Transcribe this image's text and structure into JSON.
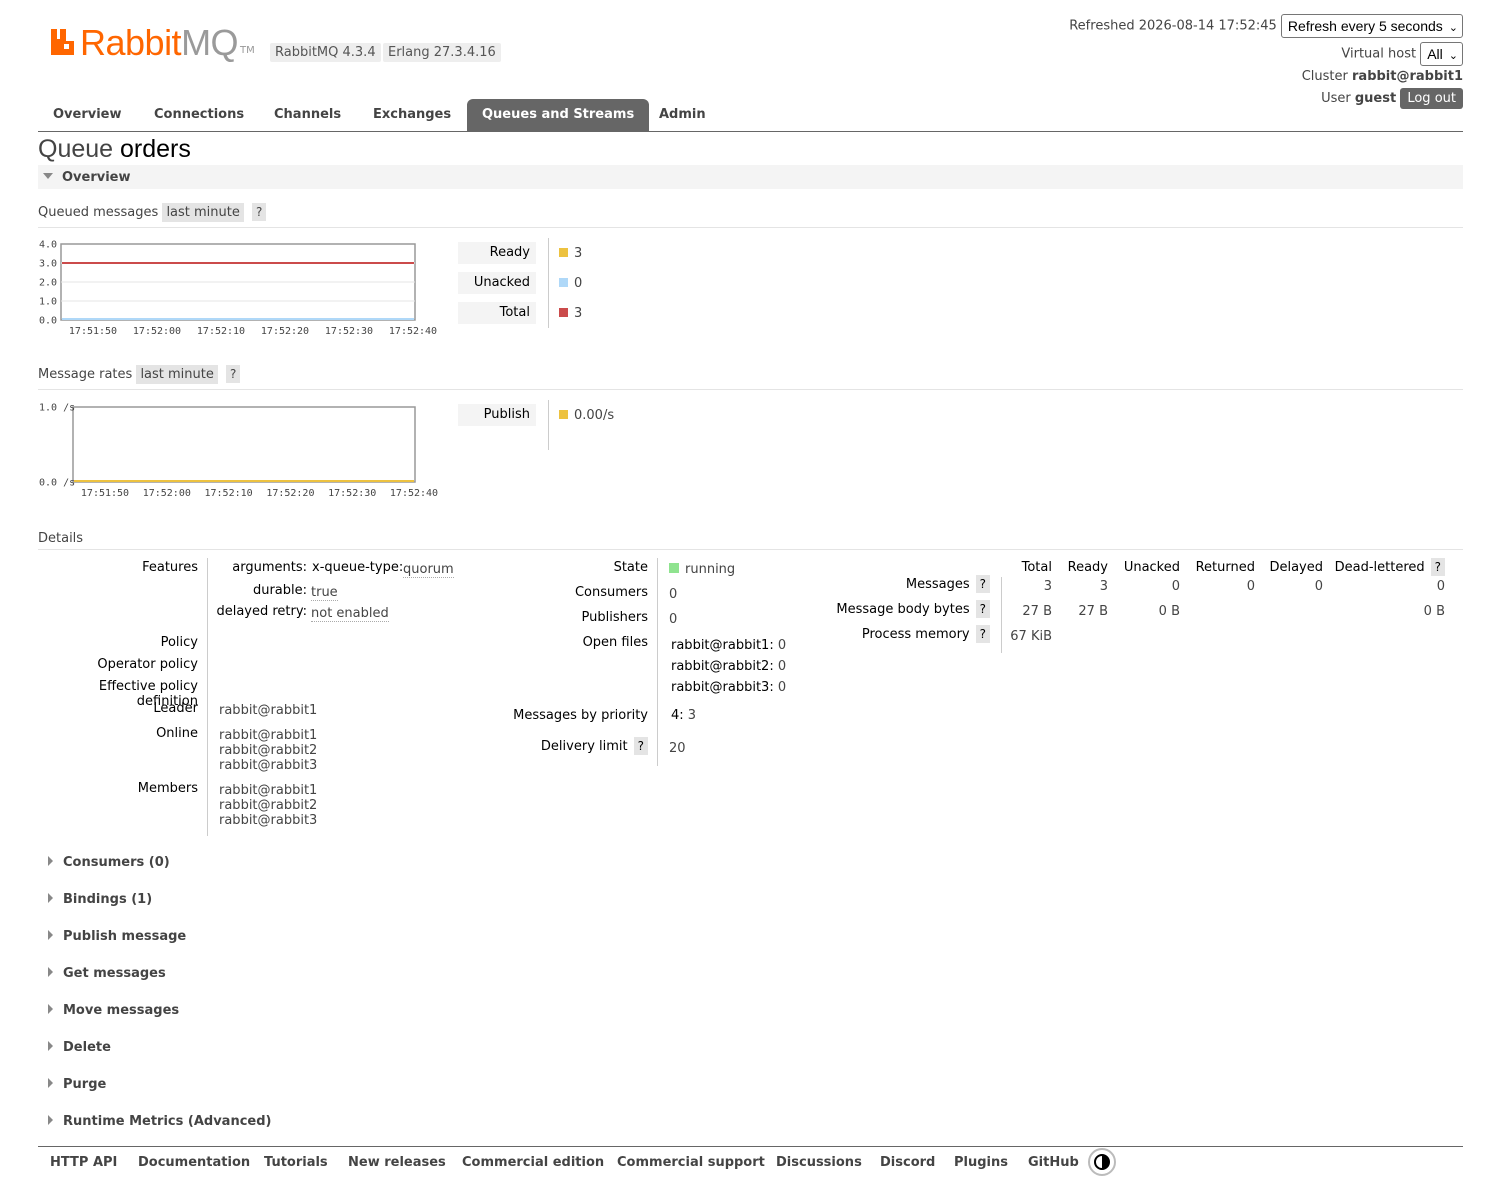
{
  "header": {
    "logo_rabbit": "Rabbit",
    "logo_mq": "MQ",
    "logo_tm": "TM",
    "rabbitmq_version": "RabbitMQ 4.3.4",
    "erlang_version": "Erlang 27.3.4.16",
    "refreshed_label": "Refreshed 2026-08-14 17:52:45",
    "refresh_select": "Refresh every 5 seconds",
    "vhost_label": "Virtual host",
    "vhost_select": "All",
    "cluster_label": "Cluster",
    "cluster_name": "rabbit@rabbit1",
    "user_label": "User",
    "user_name": "guest",
    "logout_label": "Log out"
  },
  "tabs": [
    "Overview",
    "Connections",
    "Channels",
    "Exchanges",
    "Queues and Streams",
    "Admin"
  ],
  "active_tab": "Queues and Streams",
  "page": {
    "title_prefix": "Queue",
    "queue_name": "orders",
    "overview_section": "Overview"
  },
  "queued_messages": {
    "heading": "Queued messages",
    "range": "last minute",
    "help": "?",
    "legend": [
      {
        "label": "Ready",
        "value": "3",
        "color": "#edc240"
      },
      {
        "label": "Unacked",
        "value": "0",
        "color": "#afd8f8"
      },
      {
        "label": "Total",
        "value": "3",
        "color": "#cb4b4b"
      }
    ]
  },
  "message_rates": {
    "heading": "Message rates",
    "range": "last minute",
    "help": "?",
    "legend": [
      {
        "label": "Publish",
        "value": "0.00/s",
        "color": "#edc240"
      }
    ]
  },
  "chart_data": [
    {
      "type": "line",
      "title": "Queued messages",
      "x": [
        "17:51:50",
        "17:52:00",
        "17:52:10",
        "17:52:20",
        "17:52:30",
        "17:52:40"
      ],
      "y_ticks": [
        "0.0",
        "1.0",
        "2.0",
        "3.0",
        "4.0"
      ],
      "ylim": [
        0,
        4
      ],
      "series": [
        {
          "name": "Ready",
          "color": "#edc240",
          "values": [
            3,
            3,
            3,
            3,
            3,
            3
          ]
        },
        {
          "name": "Unacked",
          "color": "#afd8f8",
          "values": [
            0,
            0,
            0,
            0,
            0,
            0
          ]
        },
        {
          "name": "Total",
          "color": "#cb4b4b",
          "values": [
            3,
            3,
            3,
            3,
            3,
            3
          ]
        }
      ],
      "grid": true
    },
    {
      "type": "line",
      "title": "Message rates",
      "x": [
        "17:51:50",
        "17:52:00",
        "17:52:10",
        "17:52:20",
        "17:52:30",
        "17:52:40"
      ],
      "y_ticks": [
        "0.0 /s",
        "1.0 /s"
      ],
      "ylim": [
        0,
        1
      ],
      "series": [
        {
          "name": "Publish",
          "color": "#edc240",
          "values": [
            0,
            0,
            0,
            0,
            0,
            0
          ]
        }
      ],
      "grid": false
    }
  ],
  "details": {
    "heading": "Details",
    "features_label": "Features",
    "feature_rows": [
      {
        "key": "arguments:",
        "subkey": "x-queue-type:",
        "value": "quorum"
      },
      {
        "key": "durable:",
        "value": "true"
      },
      {
        "key": "delayed retry:",
        "value": "not enabled"
      }
    ],
    "policy_label": "Policy",
    "operator_policy_label": "Operator policy",
    "effective_policy_label": "Effective policy definition",
    "leader_label": "Leader",
    "leader": "rabbit@rabbit1",
    "online_label": "Online",
    "online": [
      "rabbit@rabbit1",
      "rabbit@rabbit2",
      "rabbit@rabbit3"
    ],
    "members_label": "Members",
    "members": [
      "rabbit@rabbit1",
      "rabbit@rabbit2",
      "rabbit@rabbit3"
    ],
    "state_label": "State",
    "state": "running",
    "state_color": "#8fe38f",
    "consumers_label": "Consumers",
    "consumers": "0",
    "publishers_label": "Publishers",
    "publishers": "0",
    "open_files_label": "Open files",
    "open_files": [
      {
        "node": "rabbit@rabbit1:",
        "count": "0"
      },
      {
        "node": "rabbit@rabbit2:",
        "count": "0"
      },
      {
        "node": "rabbit@rabbit3:",
        "count": "0"
      }
    ],
    "priority_label": "Messages by priority",
    "priority_key": "4:",
    "priority_value": "3",
    "delivery_limit_label": "Delivery limit",
    "delivery_limit": "20",
    "stats_headers": [
      "Total",
      "Ready",
      "Unacked",
      "Returned",
      "Delayed",
      "Dead-lettered"
    ],
    "stats_rows": [
      {
        "label": "Messages",
        "values": [
          "3",
          "3",
          "0",
          "0",
          "0",
          "0"
        ]
      },
      {
        "label": "Message body bytes",
        "values": [
          "27 B",
          "27 B",
          "0 B",
          "",
          "",
          "0 B"
        ]
      },
      {
        "label": "Process memory",
        "values": [
          "67 KiB",
          "",
          "",
          "",
          "",
          ""
        ]
      }
    ]
  },
  "collapsed_sections": [
    "Consumers (0)",
    "Bindings (1)",
    "Publish message",
    "Get messages",
    "Move messages",
    "Delete",
    "Purge",
    "Runtime Metrics (Advanced)"
  ],
  "footer_links": [
    "HTTP API",
    "Documentation",
    "Tutorials",
    "New releases",
    "Commercial edition",
    "Commercial support",
    "Discussions",
    "Discord",
    "Plugins",
    "GitHub"
  ]
}
